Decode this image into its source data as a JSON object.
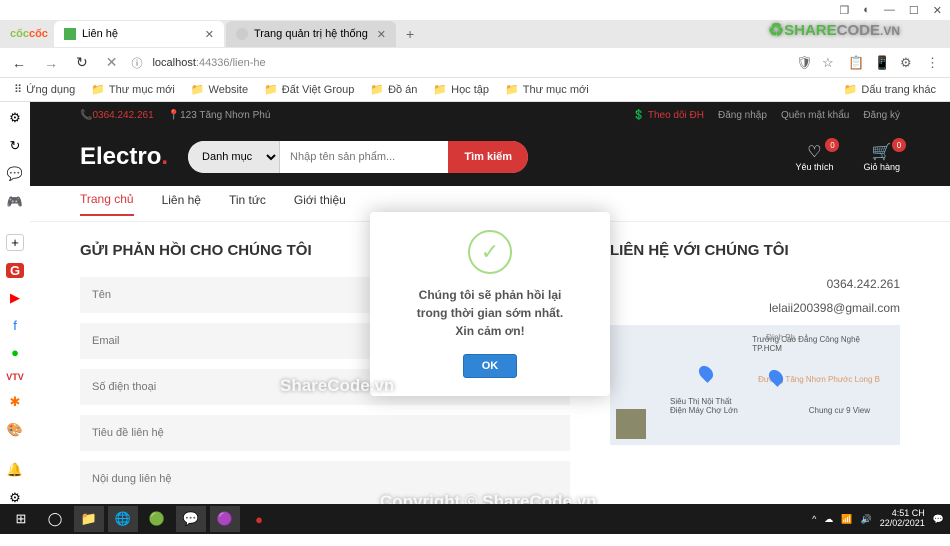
{
  "browser": {
    "titlebar_actions": {
      "restore": "❐",
      "theme": "◐",
      "min": "—",
      "max": "☐",
      "close": "✕"
    },
    "logo": {
      "part1": "cốc",
      "part2": "cốc"
    },
    "tabs": [
      {
        "title": "Liên hệ",
        "close": "✕",
        "active": true
      },
      {
        "title": "Trang quản trị hệ thống",
        "close": "✕",
        "active": false
      }
    ],
    "add_tab": "+",
    "nav": {
      "back": "←",
      "fwd": "→",
      "reload": "↻",
      "close": "✕",
      "lock": "ⓘ"
    },
    "url": {
      "host": "localhost",
      "port": ":44336",
      "path": "/lien-he"
    },
    "addr_icons": [
      "🛡",
      "☆",
      "📋",
      "📱",
      "⚙",
      "⋮"
    ],
    "bookmarks": [
      "Ứng dụng",
      "Thư mục mới",
      "Website",
      "Đất Việt Group",
      "Đồ án",
      "Học tập",
      "Thư mục mới"
    ],
    "bm_other": "Dấu trang khác"
  },
  "sidebar_icons": [
    "⚙",
    "↻",
    "💬",
    "🎮",
    "",
    "+",
    "G",
    "▶",
    "f",
    "●",
    "VTV",
    "✱",
    "🎨",
    "",
    "🔔",
    "⚙"
  ],
  "site": {
    "topbar": {
      "phone": "0364.242.261",
      "address": "123 Tăng Nhơn Phú",
      "track": "Theo dõi ĐH",
      "login": "Đăng nhập",
      "forgot": "Quên mật khẩu",
      "register": "Đăng ký"
    },
    "logo": {
      "name": "Electro",
      "dot": "."
    },
    "search": {
      "category": "Danh mục",
      "placeholder": "Nhập tên sản phẩm...",
      "button": "Tìm kiếm"
    },
    "actions": {
      "wishlist": {
        "label": "Yêu thích",
        "count": "0"
      },
      "cart": {
        "label": "Giỏ hàng",
        "count": "0"
      }
    },
    "nav": [
      "Trang chủ",
      "Liên hệ",
      "Tin tức",
      "Giới thiệu"
    ],
    "feedback": {
      "title": "GỬI PHẢN HỒI CHO CHÚNG TÔI",
      "fields": {
        "name": "Tên",
        "email": "Email",
        "phone": "Số điện thoại",
        "subject": "Tiêu đề liên hệ",
        "content": "Nội dung liên hệ"
      }
    },
    "contact": {
      "title": "LIÊN HỆ VỚI CHÚNG TÔI",
      "phone": "0364.242.261",
      "email": "lelaii200398@gmail.com"
    }
  },
  "modal": {
    "line1": "Chúng tôi sẽ phản hồi lại",
    "line2": "trong thời gian sớm nhất.",
    "line3": "Xin cảm ơn!",
    "ok": "OK"
  },
  "watermark": {
    "text1": "ShareCode.vn",
    "text2": "Copyright © ShareCode.vn",
    "brand1": "SHARE",
    "brand2": "CODE",
    "brand3": ".VN"
  },
  "taskbar": {
    "items": [
      "⊞",
      "◯",
      "📁",
      "🌐",
      "🟢",
      "💬",
      "🟣",
      "●"
    ],
    "tray": [
      "^",
      "☁",
      "📶",
      "🔊"
    ],
    "time": "4:51 CH",
    "date": "22/02/2021",
    "notif": "💬"
  }
}
